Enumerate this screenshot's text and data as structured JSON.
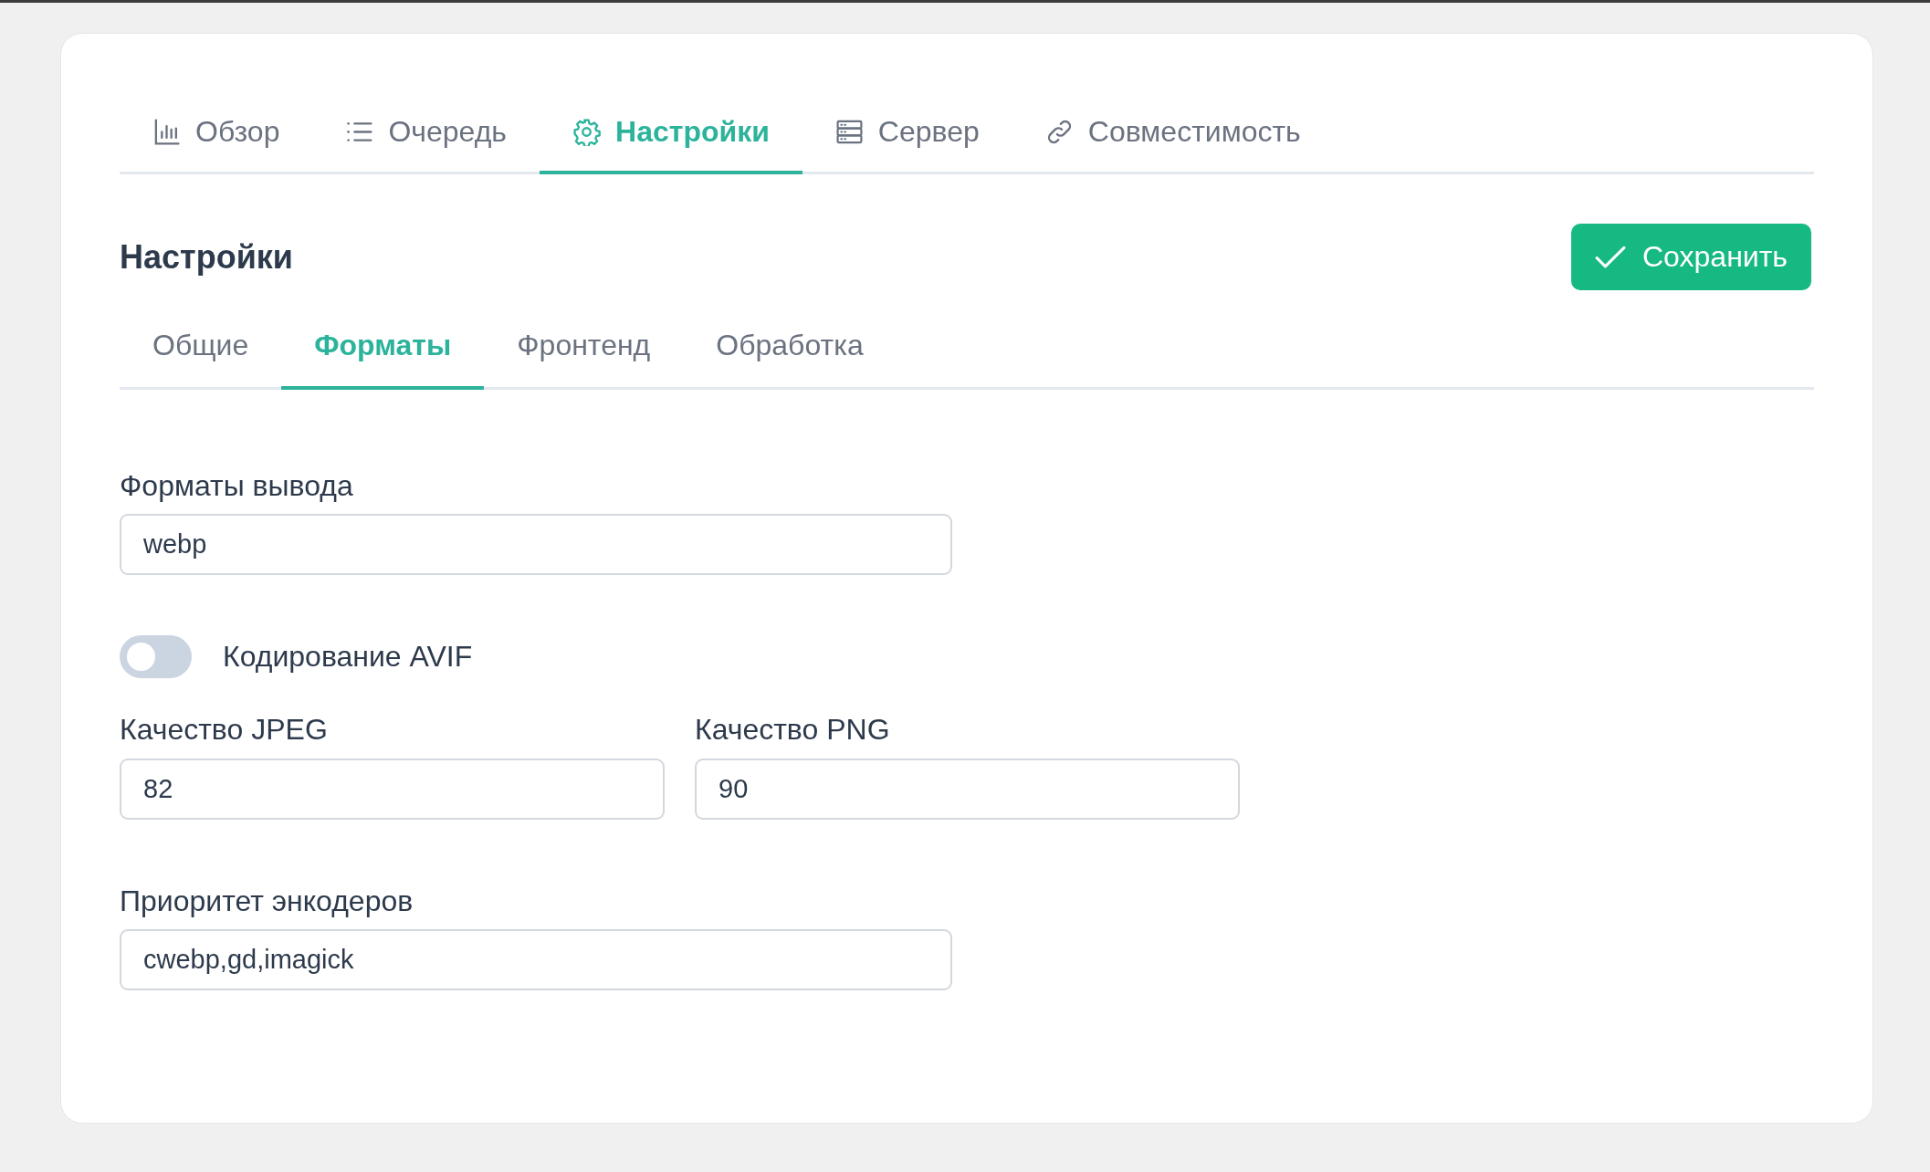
{
  "main_tabs": [
    {
      "label": "Обзор",
      "selected": false
    },
    {
      "label": "Очередь",
      "selected": false
    },
    {
      "label": "Настройки",
      "selected": true
    },
    {
      "label": "Сервер",
      "selected": false
    },
    {
      "label": "Совместимость",
      "selected": false
    }
  ],
  "section": {
    "title": "Настройки",
    "save_button": "Сохранить"
  },
  "sub_tabs": [
    {
      "label": "Общие",
      "selected": false
    },
    {
      "label": "Форматы",
      "selected": true
    },
    {
      "label": "Фронтенд",
      "selected": false
    },
    {
      "label": "Обработка",
      "selected": false
    }
  ],
  "form": {
    "output_formats": {
      "label": "Форматы вывода",
      "value": "webp"
    },
    "avif_toggle": {
      "label": "Кодирование AVIF",
      "on": false
    },
    "jpeg_quality": {
      "label": "Качество JPEG",
      "value": "82"
    },
    "png_quality": {
      "label": "Качество PNG",
      "value": "90"
    },
    "encoder_priority": {
      "label": "Приоритет энкодеров",
      "value": "cwebp,gd,imagick"
    }
  }
}
